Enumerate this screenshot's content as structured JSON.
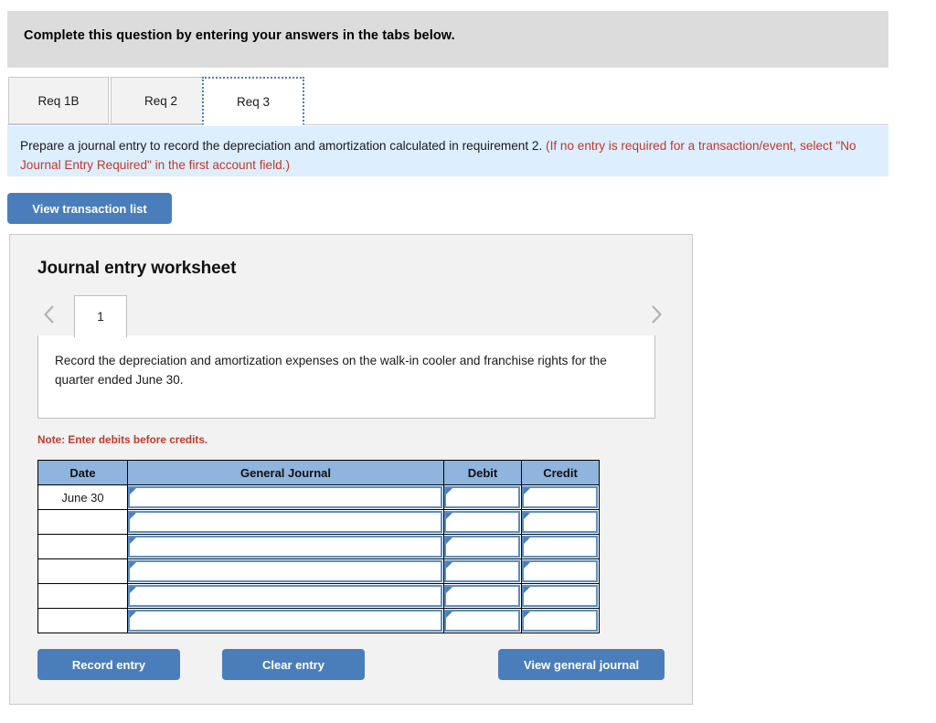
{
  "header": {
    "banner_text": "Complete this question by entering your answers in the tabs below."
  },
  "tabs": {
    "items": [
      {
        "label": "Req 1B",
        "active": false
      },
      {
        "label": "Req 2",
        "active": false
      },
      {
        "label": "Req 3",
        "active": true
      }
    ]
  },
  "instruction": {
    "main_text": "Prepare a journal entry to record the depreciation and amortization calculated in requirement 2. ",
    "red_text": "(If no entry is required for a transaction/event, select \"No Journal Entry Required\" in the first account field.)"
  },
  "toolbar": {
    "view_transaction_list_label": "View transaction list"
  },
  "worksheet": {
    "title": "Journal entry worksheet",
    "prev_icon": "chevron-left-icon",
    "next_icon": "chevron-right-icon",
    "page_tab_label": "1",
    "description": "Record the depreciation and amortization expenses on the walk-in cooler and franchise rights for the quarter ended June 30.",
    "note": "Note: Enter debits before credits."
  },
  "journal": {
    "columns": [
      "Date",
      "General Journal",
      "Debit",
      "Credit"
    ],
    "rows": [
      {
        "date": "June 30",
        "general_journal": "",
        "debit": "",
        "credit": ""
      },
      {
        "date": "",
        "general_journal": "",
        "debit": "",
        "credit": ""
      },
      {
        "date": "",
        "general_journal": "",
        "debit": "",
        "credit": ""
      },
      {
        "date": "",
        "general_journal": "",
        "debit": "",
        "credit": ""
      },
      {
        "date": "",
        "general_journal": "",
        "debit": "",
        "credit": ""
      },
      {
        "date": "",
        "general_journal": "",
        "debit": "",
        "credit": ""
      }
    ]
  },
  "footer": {
    "record_entry_label": "Record entry",
    "clear_entry_label": "Clear entry",
    "view_general_journal_label": "View general journal"
  },
  "colors": {
    "accent_blue": "#4a7ebb",
    "header_gray": "#dcdcdc",
    "info_blue": "#ddeeff",
    "note_red": "#c0392b",
    "table_header_blue": "#8fb4de",
    "panel_gray": "#f2f2f2"
  }
}
